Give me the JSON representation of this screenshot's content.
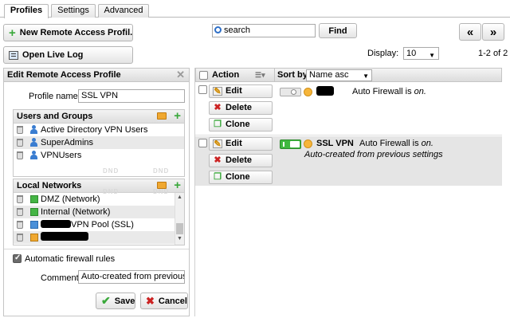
{
  "tabs": [
    {
      "label": "Profiles",
      "active": true
    },
    {
      "label": "Settings",
      "active": false
    },
    {
      "label": "Advanced",
      "active": false
    }
  ],
  "toolbar": {
    "new_profile_label": "New Remote Access Profil...",
    "open_live_log_label": "Open Live Log",
    "search_placeholder": "search",
    "find_label": "Find",
    "display_label": "Display:",
    "display_value": "10",
    "pagination": "1-2 of 2",
    "first_page_glyph": "«",
    "last_page_glyph": "»"
  },
  "edit_panel": {
    "title": "Edit Remote Access Profile",
    "profile_name_label": "Profile name:",
    "profile_name_value": "SSL VPN",
    "users_groups": {
      "title": "Users and Groups",
      "items": [
        "Active Directory VPN Users",
        "SuperAdmins",
        "VPNUsers"
      ],
      "watermark": "DND"
    },
    "local_networks": {
      "title": "Local Networks",
      "items": [
        "DMZ (Network)",
        "Internal (Network)",
        "VPN Pool (SSL)",
        ""
      ],
      "watermark": "DND"
    },
    "auto_firewall_label": "Automatic firewall rules",
    "auto_firewall_checked": true,
    "comment_label": "Comment:",
    "comment_value": "Auto-created from previous se",
    "save_label": "Save",
    "cancel_label": "Cancel"
  },
  "list": {
    "action_header": "Action",
    "sort_by_label": "Sort by:",
    "sort_value": "Name asc",
    "rows": [
      {
        "edit": "Edit",
        "delete": "Delete",
        "clone": "Clone",
        "name": "",
        "enabled": false,
        "status_prefix": "Auto Firewall is ",
        "status_value": "on.",
        "comment": ""
      },
      {
        "edit": "Edit",
        "delete": "Delete",
        "clone": "Clone",
        "name": "SSL VPN",
        "enabled": true,
        "status_prefix": "Auto Firewall is ",
        "status_value": "on.",
        "comment": "Auto-created from previous settings"
      }
    ]
  },
  "colors": {
    "accent_green": "#39a83a",
    "delete_red": "#cc2222",
    "selected_row": "#e5e5e5"
  }
}
